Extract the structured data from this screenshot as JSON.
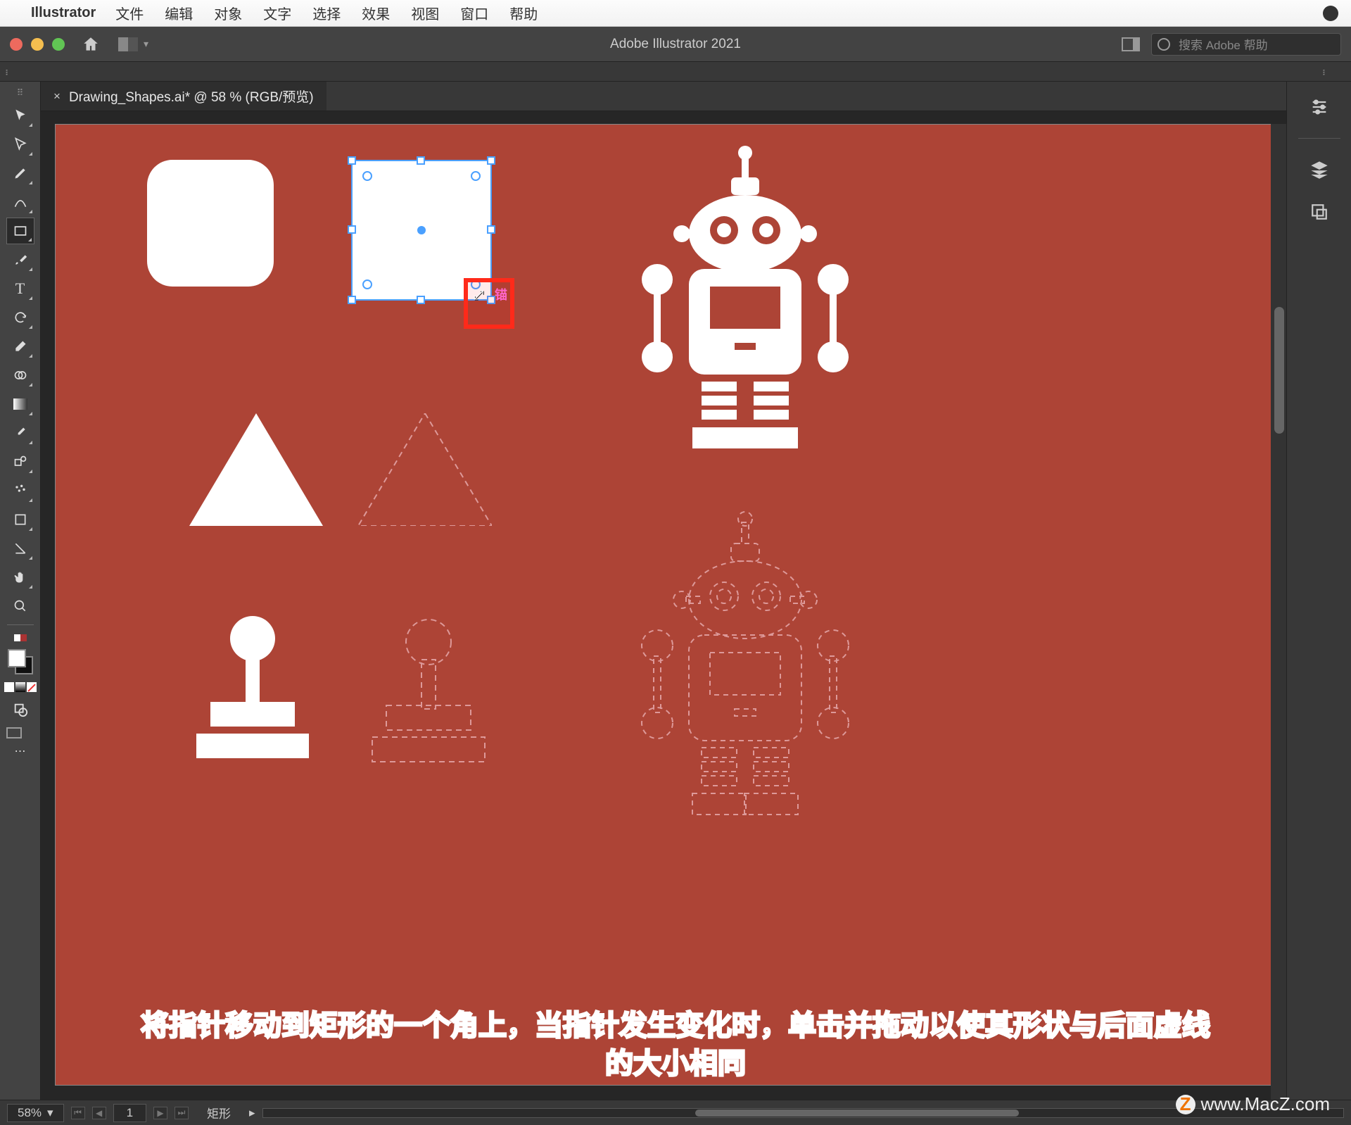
{
  "menubar": {
    "app_name": "Illustrator",
    "items": [
      "文件",
      "编辑",
      "对象",
      "文字",
      "选择",
      "效果",
      "视图",
      "窗口",
      "帮助"
    ]
  },
  "titlebar": {
    "title": "Adobe Illustrator 2021",
    "search_placeholder": "搜索 Adobe 帮助"
  },
  "tab": {
    "filename": "Drawing_Shapes.ai* @ 58 % (RGB/预览)"
  },
  "canvas": {
    "bg_color": "#ad4436",
    "cursor_hint_label": "锚"
  },
  "statusbar": {
    "zoom": "58%",
    "artboard": "1",
    "selection_type": "矩形"
  },
  "right_dock": {
    "icons": [
      "properties-icon",
      "layers-icon",
      "artboards-icon"
    ]
  },
  "tools": [
    "selection-tool",
    "direct-selection-tool",
    "pen-tool",
    "curvature-tool",
    "rectangle-tool",
    "paintbrush-tool",
    "type-tool",
    "rotate-tool",
    "eraser-tool",
    "shape-builder-tool",
    "gradient-tool",
    "eyedropper-tool",
    "blend-tool",
    "symbol-sprayer-tool",
    "artboard-tool",
    "slice-tool",
    "hand-tool",
    "zoom-tool"
  ],
  "caption": {
    "line1": "将指针移动到矩形的一个角上，当指针发生变化时，单击并拖动以使其形状与后面虚线",
    "line2": "的大小相同"
  },
  "watermark": "www.MacZ.com"
}
